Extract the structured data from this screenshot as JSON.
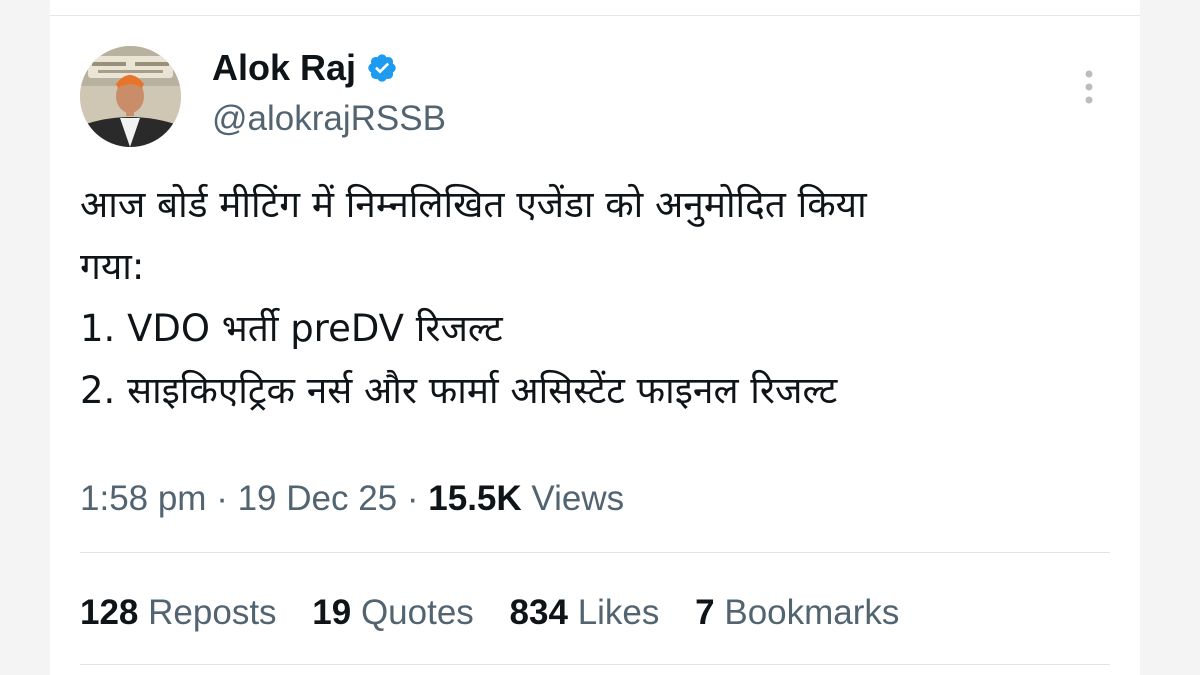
{
  "author": {
    "display_name": "Alok Raj",
    "handle": "@alokrajRSSB",
    "verified": true,
    "avatar_icon": "profile-photo"
  },
  "tweet": {
    "lines": [
      "आज बोर्ड मीटिंग में निम्नलिखित एजेंडा को अनुमोदित किया",
      "गया:",
      "1. VDO भर्ती preDV रिजल्ट",
      "2. साइकिएट्रिक नर्स और फार्मा असिस्टेंट फाइनल रिजल्ट"
    ]
  },
  "meta": {
    "time": "1:58 pm",
    "separator": "·",
    "date": "19 Dec 25",
    "views_count": "15.5K",
    "views_label": "Views"
  },
  "stats": {
    "reposts_count": "128",
    "reposts_label": "Reposts",
    "quotes_count": "19",
    "quotes_label": "Quotes",
    "likes_count": "834",
    "likes_label": "Likes",
    "bookmarks_count": "7",
    "bookmarks_label": "Bookmarks"
  },
  "colors": {
    "verified_badge": "#1d9bf0",
    "primary_text": "#0f1419",
    "secondary_text": "#536471"
  }
}
